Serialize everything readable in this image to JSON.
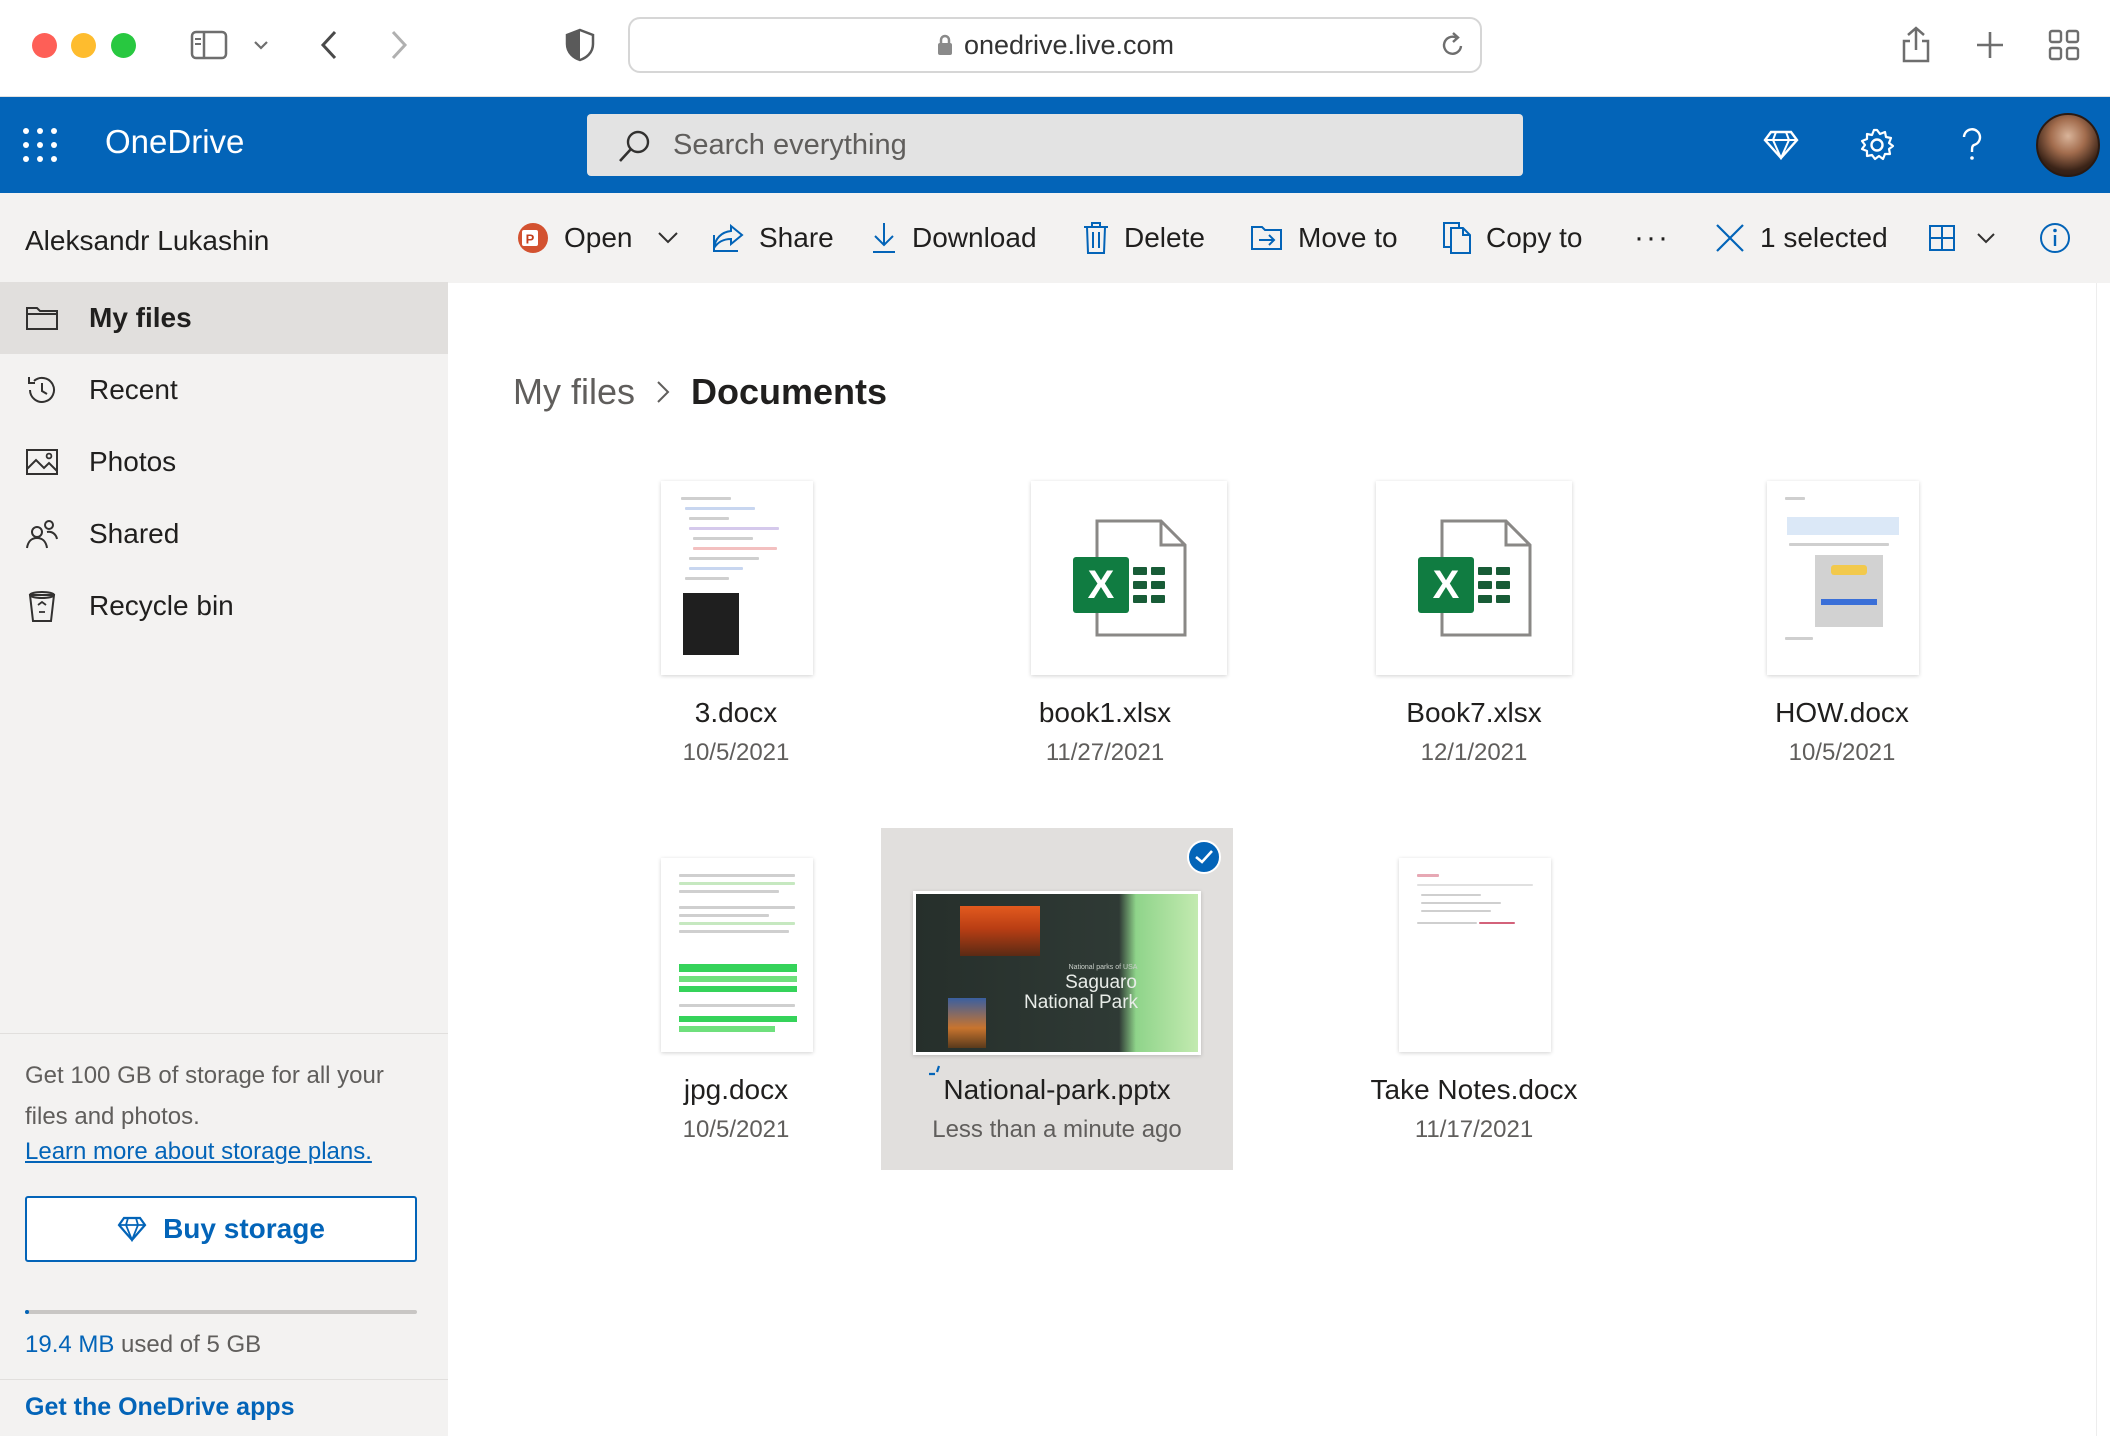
{
  "browser": {
    "url": "onedrive.live.com"
  },
  "header": {
    "app_title": "OneDrive",
    "search_placeholder": "Search everything"
  },
  "nav": {
    "user_name": "Aleksandr Lukashin",
    "items": [
      {
        "label": "My files",
        "icon": "folder-icon",
        "active": true
      },
      {
        "label": "Recent",
        "icon": "history-icon",
        "active": false
      },
      {
        "label": "Photos",
        "icon": "image-icon",
        "active": false
      },
      {
        "label": "Shared",
        "icon": "people-icon",
        "active": false
      },
      {
        "label": "Recycle bin",
        "icon": "recycle-bin-icon",
        "active": false
      }
    ],
    "promo_text": "Get 100 GB of storage for all your files and photos.",
    "promo_link": "Learn more about storage plans.",
    "buy_label": "Buy storage",
    "storage_used": "19.4 MB",
    "storage_rest": " used of 5 GB",
    "storage_fraction": 0.004,
    "get_apps": "Get the OneDrive apps"
  },
  "commands": {
    "open": "Open",
    "share": "Share",
    "download": "Download",
    "delete": "Delete",
    "move_to": "Move to",
    "copy_to": "Copy to",
    "more": "···",
    "selected": "1 selected"
  },
  "breadcrumb": {
    "parent": "My files",
    "current": "Documents"
  },
  "files": [
    {
      "name": "3.docx",
      "date": "10/5/2021",
      "type": "docx-code"
    },
    {
      "name": "book1.xlsx",
      "date": "11/27/2021",
      "type": "xlsx"
    },
    {
      "name": "Book7.xlsx",
      "date": "12/1/2021",
      "type": "xlsx"
    },
    {
      "name": "HOW.docx",
      "date": "10/5/2021",
      "type": "docx-screenshot"
    },
    {
      "name": "jpg.docx",
      "date": "10/5/2021",
      "type": "docx-highlight"
    },
    {
      "name": "National-park.pptx",
      "date": "Less than a minute ago",
      "type": "pptx",
      "selected": true,
      "slide_small": "National parks of USA",
      "slide_title_1": "Saguaro",
      "slide_title_2": "National Park"
    },
    {
      "name": "Take Notes.docx",
      "date": "11/17/2021",
      "type": "docx-notes"
    }
  ],
  "colors": {
    "brand": "#0364b8",
    "excel": "#107c41"
  }
}
